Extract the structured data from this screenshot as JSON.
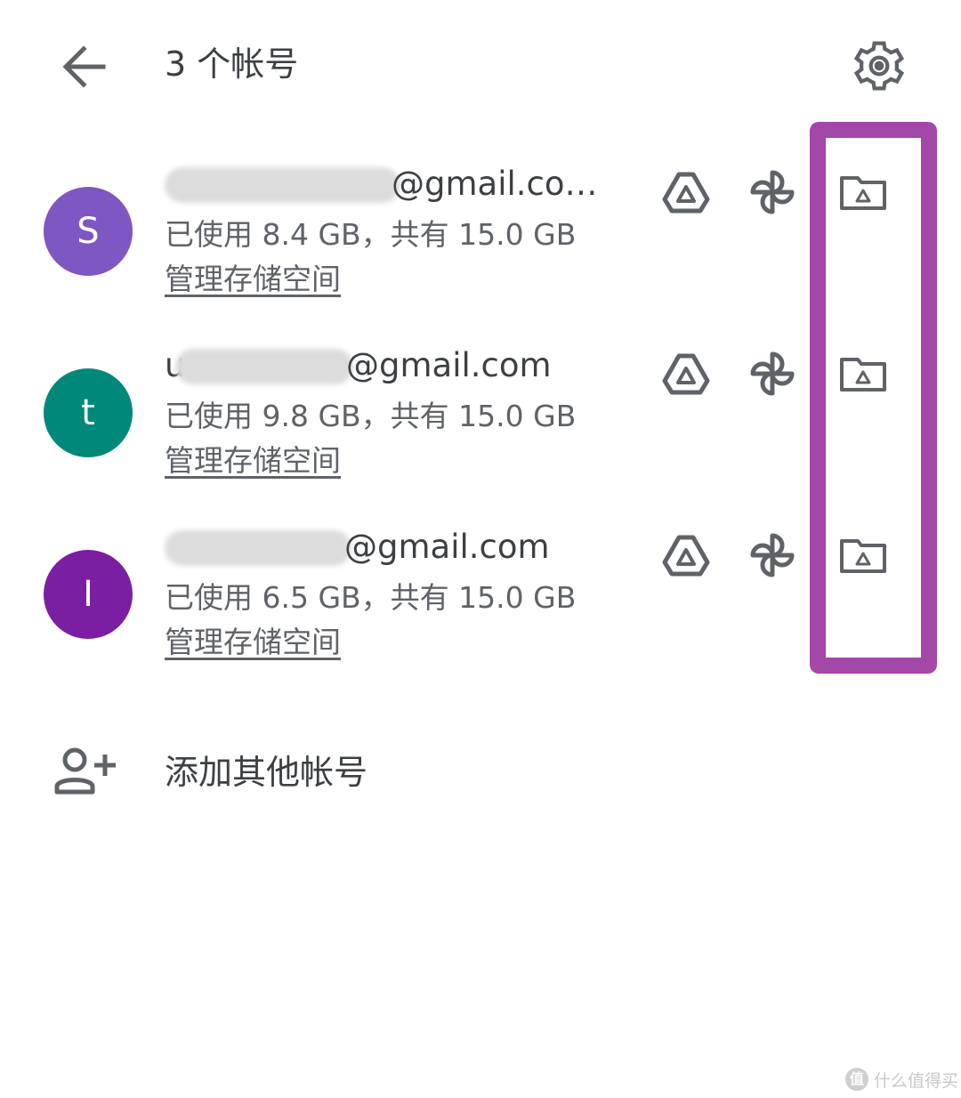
{
  "header": {
    "title": "3 个帐号",
    "back_icon": "arrow-back-icon",
    "settings_icon": "gear-icon"
  },
  "accounts": [
    {
      "initial": "S",
      "avatar_color": "#7e57c2",
      "email_visible": "@gmail.co…",
      "usage": "已使用 8.4 GB，共有 15.0 GB",
      "manage_label": "管理存储空间"
    },
    {
      "initial": "t",
      "avatar_color": "#00897b",
      "email_visible": "@gmail.com",
      "email_prefix": "u",
      "usage": "已使用 9.8 GB，共有 15.0 GB",
      "manage_label": "管理存储空间"
    },
    {
      "initial": "I",
      "avatar_color": "#7b1fa2",
      "email_visible": "@gmail.com",
      "usage": "已使用 6.5 GB，共有 15.0 GB",
      "manage_label": "管理存储空间"
    }
  ],
  "row_icons": [
    "google-drive-icon",
    "google-photos-pinwheel-icon",
    "drive-folder-icon"
  ],
  "highlight_color": "#a347a8",
  "add_account": {
    "label": "添加其他帐号",
    "icon": "add-person-icon"
  },
  "watermark": {
    "logo": "值",
    "text": "什么值得买"
  }
}
